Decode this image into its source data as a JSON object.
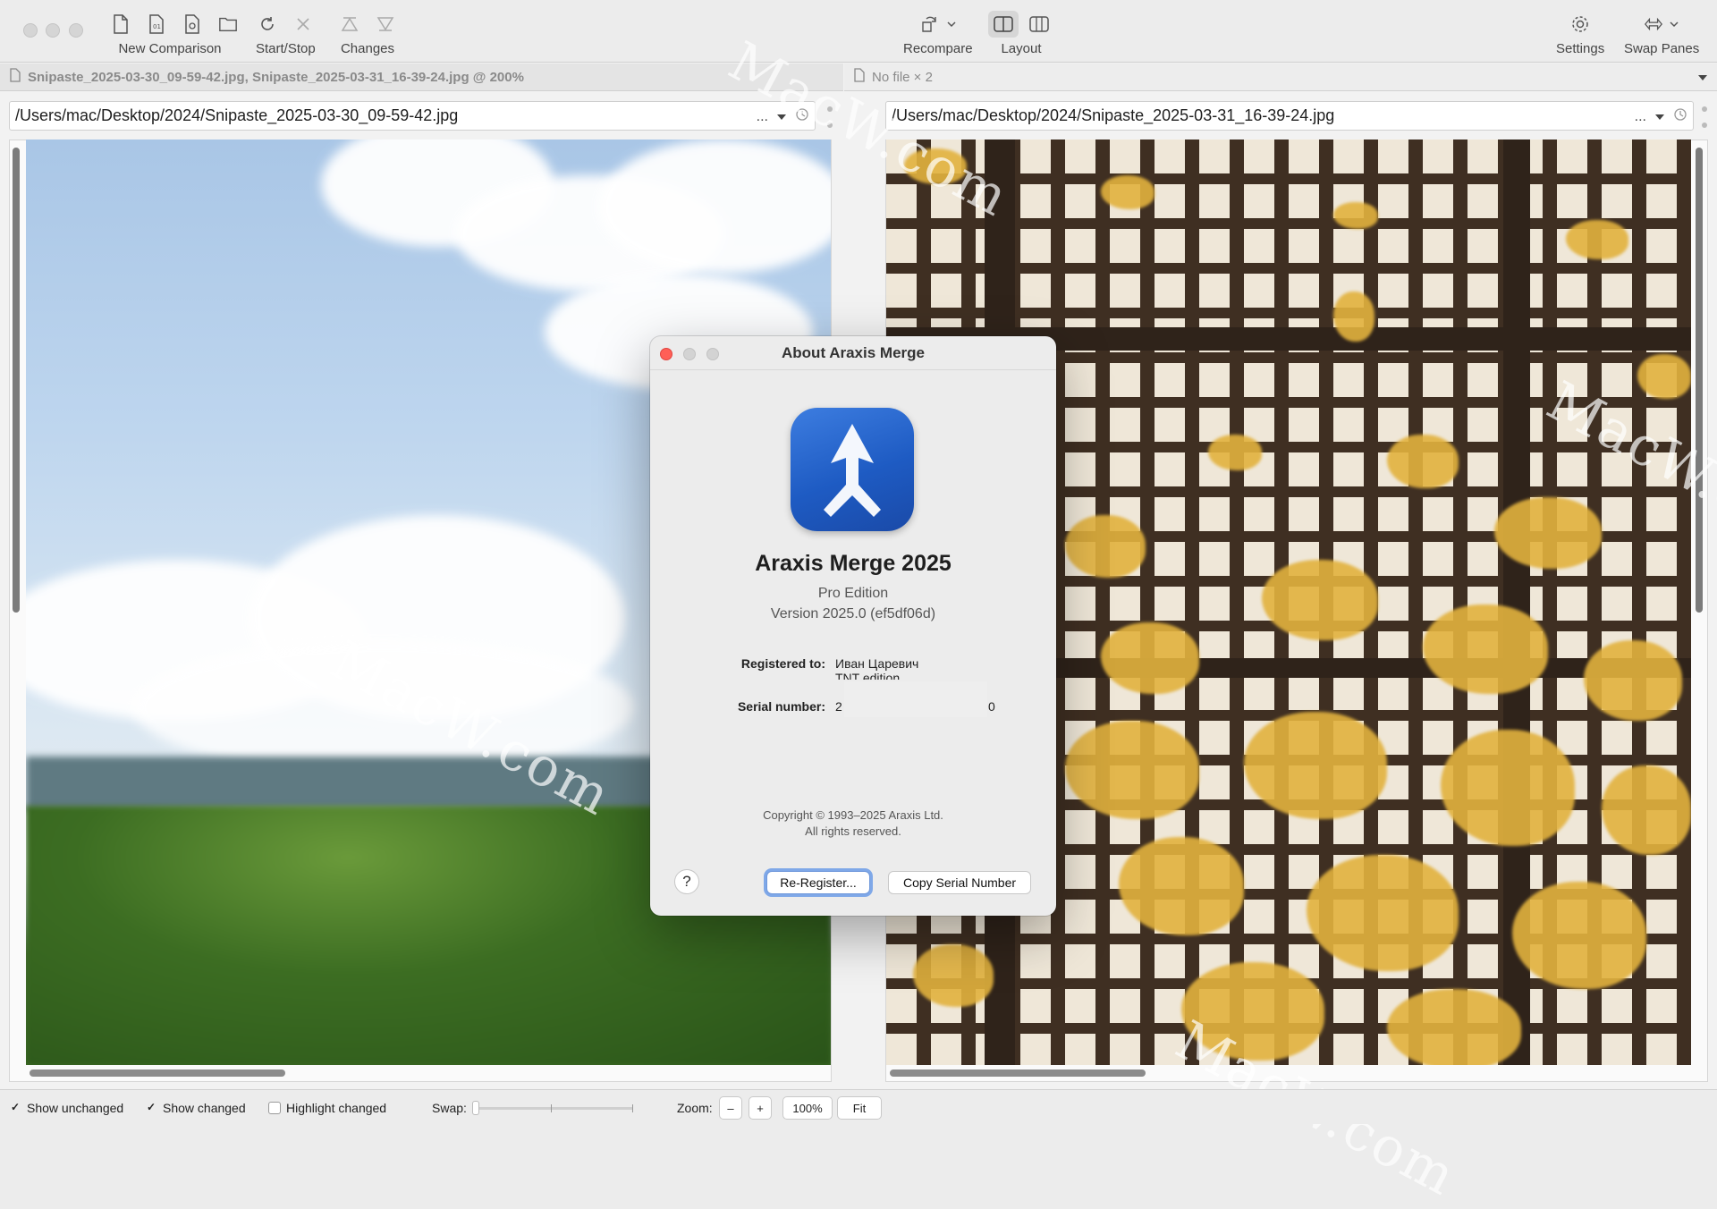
{
  "toolbar": {
    "new_comparison": "New Comparison",
    "start_stop": "Start/Stop",
    "changes": "Changes",
    "recompare": "Recompare",
    "layout": "Layout",
    "settings": "Settings",
    "swap_panes": "Swap Panes",
    "icons": [
      "new-file-icon",
      "new-binary-icon",
      "new-image-icon",
      "new-folder-icon",
      "refresh-icon",
      "stop-icon",
      "prev-change-icon",
      "next-change-icon",
      "recompare-icon",
      "layout-side-by-side-icon",
      "layout-split-icon",
      "gear-icon",
      "swap-icon"
    ]
  },
  "left_pane": {
    "title": "Snipaste_2025-03-30_09-59-42.jpg, Snipaste_2025-03-31_16-39-24.jpg @ 200%",
    "path": "/Users/mac/Desktop/2024/Snipaste_2025-03-30_09-59-42.jpg",
    "more": "..."
  },
  "right_pane": {
    "title": "No file × 2",
    "path": "/Users/mac/Desktop/2024/Snipaste_2025-03-31_16-39-24.jpg",
    "more": "..."
  },
  "watermark": "MacW.com",
  "status": {
    "show_unchanged": "Show unchanged",
    "show_changed": "Show changed",
    "highlight_changed": "Highlight changed",
    "swap": "Swap:",
    "zoom": "Zoom:",
    "zoom_out": "–",
    "zoom_in": "+",
    "zoom_value": "100%",
    "fit": "Fit",
    "checkmark": "✓"
  },
  "dialog": {
    "title": "About Araxis Merge",
    "app_name": "Araxis Merge 2025",
    "edition": "Pro Edition",
    "version": "Version 2025.0 (ef5df06d)",
    "registered_label": "Registered to:",
    "registered_name": "Иван Царевич",
    "registered_sub": "TNT edition",
    "serial_label": "Serial number:",
    "serial_start": "2",
    "serial_end": "0",
    "copyright": "Copyright © 1993–2025 Araxis Ltd.",
    "rights": "All rights reserved.",
    "help": "?",
    "reregister": "Re-Register...",
    "copy_serial": "Copy Serial Number"
  }
}
